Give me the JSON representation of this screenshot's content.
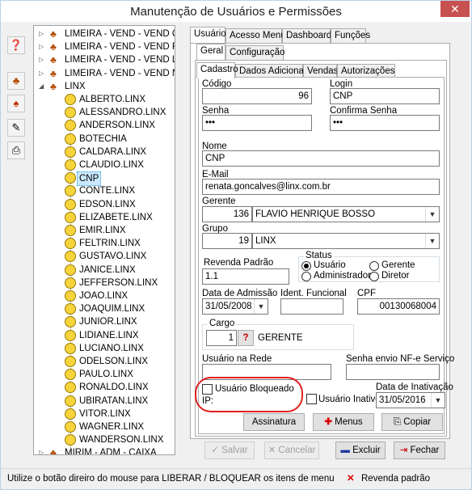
{
  "window": {
    "title": "Manutenção de Usuários e Permissões",
    "close": "✕"
  },
  "toolbar": [
    "help-icon",
    "users-icon",
    "user-permission-icon",
    "edit-icon",
    "print-icon"
  ],
  "tree": {
    "groups_top": [
      "LIMEIRA - VEND - VEND CON",
      "LIMEIRA - VEND - VEND FRO",
      "LIMEIRA - VEND - VEND LIDE",
      "LIMEIRA - VEND - VEND NOV"
    ],
    "open_group": "LINX",
    "users": [
      "ALBERTO.LINX",
      "ALESSANDRO.LINX",
      "ANDERSON.LINX",
      "BOTECHIA",
      "CALDARA.LINX",
      "CLAUDIO.LINX",
      "CNP",
      "CONTE.LINX",
      "EDSON.LINX",
      "ELIZABETE.LINX",
      "EMIR.LINX",
      "FELTRIN.LINX",
      "GUSTAVO.LINX",
      "JANICE.LINX",
      "JEFFERSON.LINX",
      "JOAO.LINX",
      "JOAQUIM.LINX",
      "JUNIOR.LINX",
      "LIDIANE.LINX",
      "LUCIANO.LINX",
      "ODELSON.LINX",
      "PAULO.LINX",
      "RONALDO.LINX",
      "UBIRATAN.LINX",
      "VITOR.LINX",
      "WAGNER.LINX",
      "WANDERSON.LINX"
    ],
    "selected": "CNP",
    "group_bottom": "MIRIM - ADM - CAIXA"
  },
  "tabs": {
    "top": [
      "Usuário",
      "Acesso Menus",
      "Dashboard",
      "Funções"
    ],
    "second": [
      "Geral",
      "Configuração"
    ],
    "third": [
      "Cadastro",
      "Dados Adicionais",
      "Vendas",
      "Autorizações"
    ]
  },
  "form": {
    "codigo_label": "Código",
    "codigo": "96",
    "login_label": "Login",
    "login": "CNP",
    "senha_label": "Senha",
    "senha": "•••",
    "confirma_label": "Confirma Senha",
    "confirma": "•••",
    "nome_label": "Nome",
    "nome": "CNP",
    "email_label": "E-Mail",
    "email": "renata.goncalves@linx.com.br",
    "gerente_label": "Gerente",
    "gerente_code": "136",
    "gerente_name": "FLAVIO HENRIQUE BOSSO",
    "grupo_label": "Grupo",
    "grupo_code": "19",
    "grupo_name": "LINX",
    "revenda_label": "Revenda Padrão",
    "revenda": "1.1",
    "status_label": "Status",
    "status_opts": [
      "Usuário",
      "Gerente",
      "Administrador",
      "Diretor"
    ],
    "admissao_label": "Data de Admissão",
    "admissao": "31/05/2008",
    "ident_label": "Ident. Funcional",
    "ident": "",
    "cpf_label": "CPF",
    "cpf": "00130068004",
    "cargo_label": "Cargo",
    "cargo_code": "1",
    "cargo_name": "GERENTE",
    "rede_label": "Usuário na Rede",
    "rede": "",
    "nfe_label": "Senha envio NF-e Serviço",
    "nfe": "",
    "bloqueado_label": "Usuário Bloqueado",
    "ip_label": "IP:",
    "inativo_label": "Usuário Inativo",
    "inativacao_label": "Data de Inativação",
    "inativacao": "31/05/2016"
  },
  "buttons": {
    "assinatura": "Assinatura",
    "menus": "Menus",
    "copiar": "Copiar",
    "salvar": "Salvar",
    "cancelar": "Cancelar",
    "excluir": "Excluir",
    "fechar": "Fechar"
  },
  "status": {
    "hint": "Utilize o botão direiro do mouse para LIBERAR / BLOQUEAR os itens de menu",
    "revenda": "Revenda padrão"
  }
}
